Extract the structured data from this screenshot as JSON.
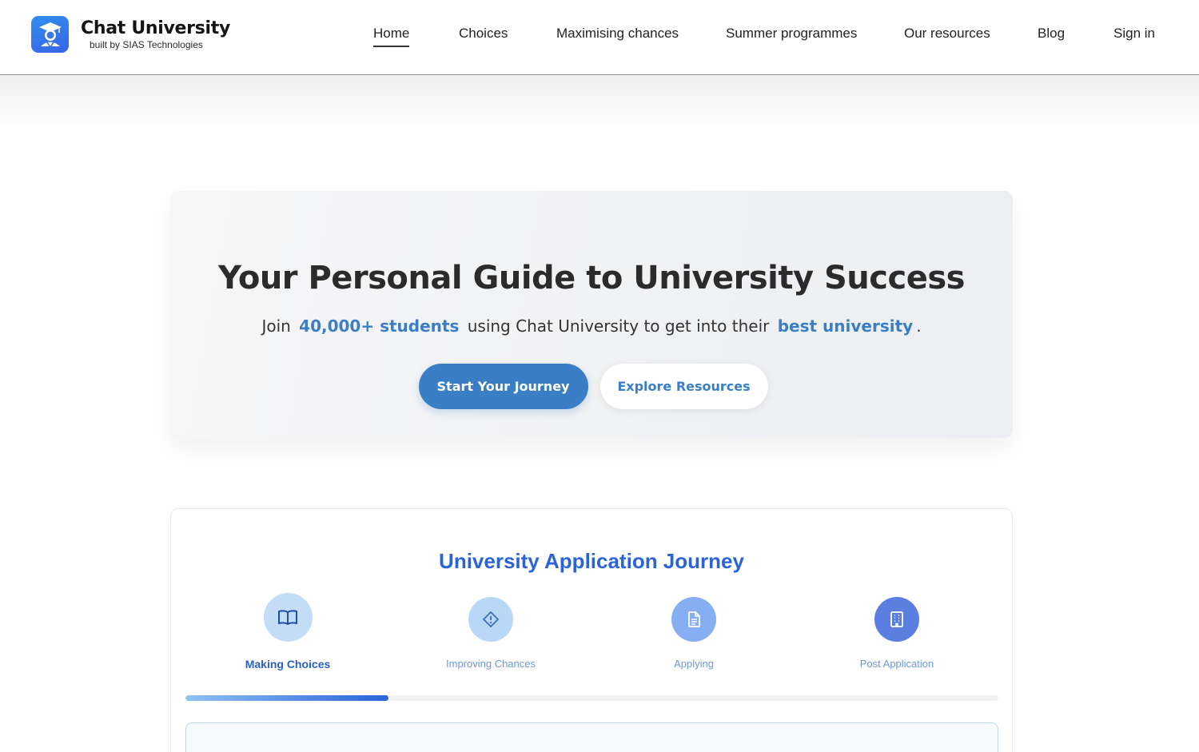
{
  "brand": {
    "name": "Chat University",
    "tagline": "built by SIAS Technologies"
  },
  "nav": {
    "items": [
      {
        "label": "Home",
        "active": true
      },
      {
        "label": "Choices",
        "active": false
      },
      {
        "label": "Maximising chances",
        "active": false
      },
      {
        "label": "Summer programmes",
        "active": false
      },
      {
        "label": "Our resources",
        "active": false
      },
      {
        "label": "Blog",
        "active": false
      },
      {
        "label": "Sign in",
        "active": false
      }
    ]
  },
  "hero": {
    "title": "Your Personal Guide to University Success",
    "sub_prefix": "Join",
    "sub_highlight_1": "40,000+ students",
    "sub_middle": "using Chat University to get into their",
    "sub_highlight_2": "best university",
    "sub_suffix": ".",
    "primary_button": "Start Your Journey",
    "secondary_button": "Explore Resources"
  },
  "journey": {
    "title": "University Application Journey",
    "steps": [
      {
        "label": "Making Choices",
        "icon": "book-icon",
        "active": true
      },
      {
        "label": "Improving Chances",
        "icon": "diamond-alert-icon",
        "active": false
      },
      {
        "label": "Applying",
        "icon": "document-icon",
        "active": false
      },
      {
        "label": "Post Application",
        "icon": "building-icon",
        "active": false
      }
    ],
    "progress_fraction": 0.25
  },
  "colors": {
    "accent": "#3a7fc6",
    "journey_title": "#2b63d9",
    "step_active_bg": "#c3dcf8",
    "step_2_bg": "#b9d8f8",
    "step_3_bg": "#86aef3",
    "step_4_bg": "#5b7fe0"
  }
}
